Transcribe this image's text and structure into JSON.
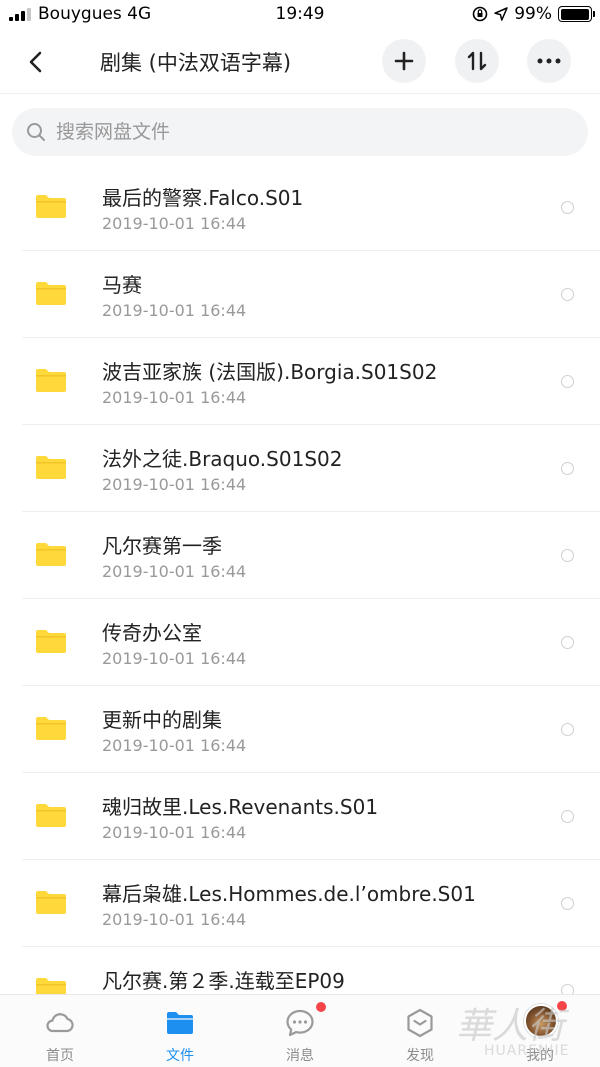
{
  "status_bar": {
    "carrier": "Bouygues 4G",
    "time": "19:49",
    "battery": "99%",
    "battery_level": 0.99
  },
  "nav": {
    "title": "剧集 (中法双语字幕)"
  },
  "search": {
    "placeholder": "搜索网盘文件"
  },
  "files": [
    {
      "name": "最后的警察.Falco.S01",
      "date": "2019-10-01 16:44"
    },
    {
      "name": "马赛",
      "date": "2019-10-01 16:44"
    },
    {
      "name": "波吉亚家族 (法国版).Borgia.S01S02",
      "date": "2019-10-01 16:44"
    },
    {
      "name": "法外之徒.Braquo.S01S02",
      "date": "2019-10-01 16:44"
    },
    {
      "name": "凡尔赛第一季",
      "date": "2019-10-01 16:44"
    },
    {
      "name": "传奇办公室",
      "date": "2019-10-01 16:44"
    },
    {
      "name": "更新中的剧集",
      "date": "2019-10-01 16:44"
    },
    {
      "name": "魂归故里.Les.Revenants.S01",
      "date": "2019-10-01 16:44"
    },
    {
      "name": "幕后枭雄.Les.Hommes.de.l’ombre.S01",
      "date": "2019-10-01 16:44"
    },
    {
      "name": "凡尔赛.第２季.连载至EP09",
      "date": ""
    }
  ],
  "tabs": [
    {
      "label": "首页",
      "icon": "cloud-icon"
    },
    {
      "label": "文件",
      "icon": "folder-icon"
    },
    {
      "label": "消息",
      "icon": "chat-bubble-icon"
    },
    {
      "label": "发现",
      "icon": "discover-icon"
    },
    {
      "label": "我的",
      "icon": "avatar"
    }
  ],
  "watermark": {
    "text": "華人街",
    "subtext": "HUARENJIE"
  },
  "colors": {
    "accent": "#1d8ff0",
    "folder": "#ffd83a",
    "badge": "#f4444a"
  }
}
